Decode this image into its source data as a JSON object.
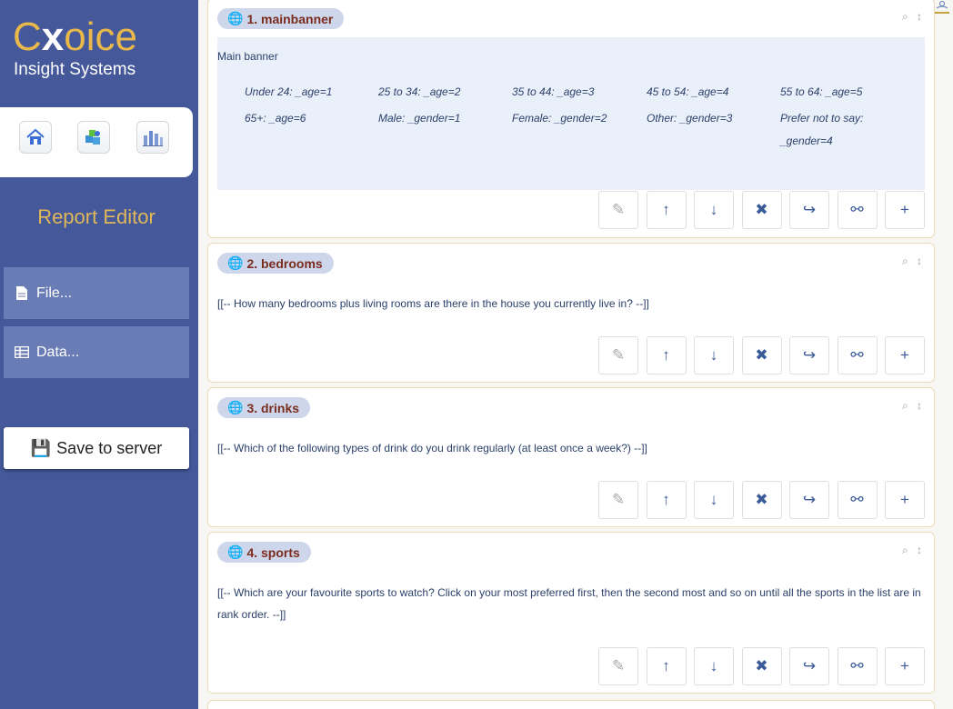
{
  "logo": {
    "main_before": "C",
    "main_x": "x",
    "main_after": "oice",
    "sub": "Insight Systems"
  },
  "toolbar_icons": [
    "home-icon",
    "puzzle-icon",
    "bar-chart-icon"
  ],
  "sidebar": {
    "section_title": "Report Editor",
    "items": [
      {
        "label": "File...",
        "icon": "file-icon"
      },
      {
        "label": "Data...",
        "icon": "table-icon"
      }
    ],
    "save_label": "Save to server"
  },
  "colors": {
    "sidebar": "#44589a",
    "sidebar_item": "#6a7cb6",
    "accent": "#e0b85a",
    "title_text": "#7a2c1e",
    "pill": "#cdd6ea"
  },
  "action_buttons": [
    "edit-icon",
    "move-up-icon",
    "move-down-icon",
    "delete-icon",
    "redirect-icon",
    "link-icon",
    "add-icon"
  ],
  "action_glyphs": [
    "✎",
    "↑",
    "↓",
    "✖",
    "↪",
    "⚯",
    "+"
  ],
  "corner_glyphs": "⌕ ↕",
  "cards": [
    {
      "title": "1. mainbanner",
      "banner_title": "Main banner",
      "banner_items": [
        "Under 24: _age=1",
        "25 to 34: _age=2",
        "35 to 44: _age=3",
        "45 to 54: _age=4",
        "55 to 64: _age=5",
        "65+: _age=6",
        "Male: _gender=1",
        "Female: _gender=2",
        "Other: _gender=3",
        "Prefer not to say: _gender=4"
      ]
    },
    {
      "title": "2. bedrooms",
      "text": "[[-- How many bedrooms plus living rooms are there in the house you currently live in? --]]"
    },
    {
      "title": "3. drinks",
      "text": "[[-- Which of the following types of drink do you drink regularly (at least once a week?) --]]"
    },
    {
      "title": "4. sports",
      "text": "[[-- Which are your favourite sports to watch? Click on your most preferred first, then the second most and so on until all the sports in the list are in rank order. --]]"
    }
  ]
}
